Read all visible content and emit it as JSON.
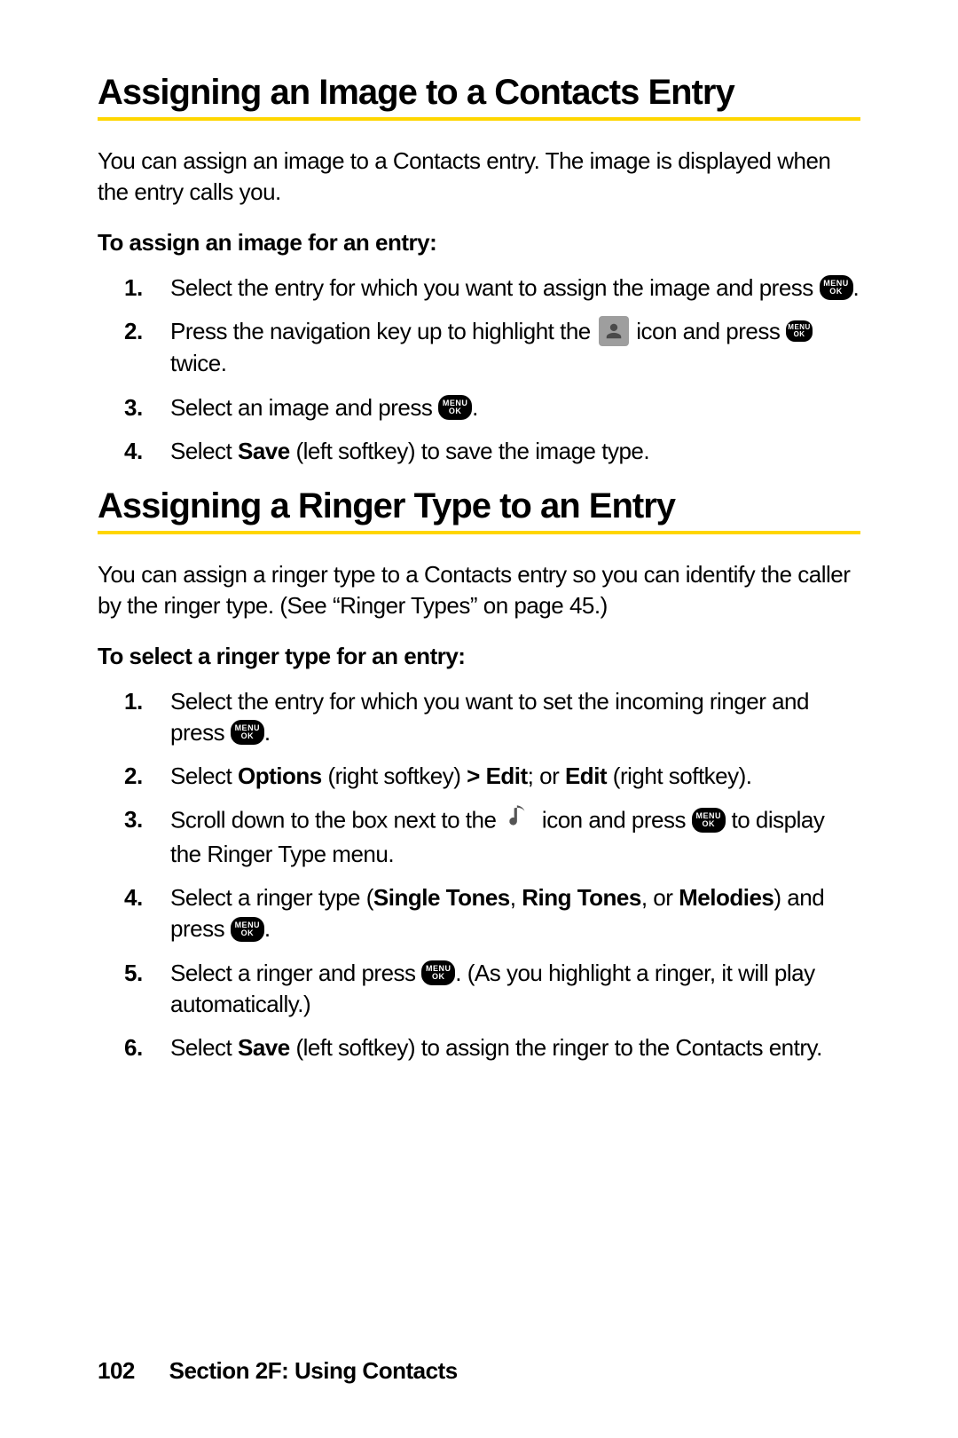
{
  "section1": {
    "heading": "Assigning an Image to a Contacts Entry",
    "intro": "You can assign an image to a Contacts entry. The image is displayed when the entry calls you.",
    "subhead": "To assign an image for an entry:",
    "steps": {
      "s1a": "Select the entry for which you want to assign the image and press ",
      "s1b": ".",
      "s2a": "Press the navigation key up to highlight the ",
      "s2b": " icon and press ",
      "s2c": " twice.",
      "s3a": "Select an image and press ",
      "s3b": ".",
      "s4a": "Select ",
      "s4_save": "Save",
      "s4b": " (left softkey) to save the image type."
    }
  },
  "section2": {
    "heading": "Assigning a Ringer Type to an Entry",
    "intro": "You can assign a ringer type to a Contacts entry so you can identify the caller by the ringer type. (See “Ringer Types” on page 45.)",
    "subhead": "To select a ringer type for an entry:",
    "steps": {
      "s1a": "Select the entry for which you want to set the incoming ringer and press ",
      "s1b": ".",
      "s2a": "Select ",
      "s2_options": "Options",
      "s2b": " (right softkey) ",
      "s2_edit1": "> Edit",
      "s2c": "; or ",
      "s2_edit2": "Edit",
      "s2d": " (right softkey).",
      "s3a": "Scroll down to the box next to the ",
      "s3b": " icon and press ",
      "s3c": " to display the Ringer Type menu.",
      "s4a": "Select a ringer type (",
      "s4_t1": "Single Tones",
      "s4b": ", ",
      "s4_t2": "Ring Tones",
      "s4c": ", or ",
      "s4_t3": "Melodies",
      "s4d": ") and press ",
      "s4e": ".",
      "s5a": "Select a ringer and press ",
      "s5b": ". (As you highlight a ringer, it will play automatically.)",
      "s6a": "Select ",
      "s6_save": "Save",
      "s6b": " (left softkey) to assign the ringer to the Contacts entry."
    }
  },
  "icons": {
    "menu_top": "MENU",
    "menu_bottom": "OK"
  },
  "footer": {
    "page": "102",
    "section": "Section 2F: Using Contacts"
  },
  "nums": {
    "n1": "1.",
    "n2": "2.",
    "n3": "3.",
    "n4": "4.",
    "n5": "5.",
    "n6": "6."
  }
}
